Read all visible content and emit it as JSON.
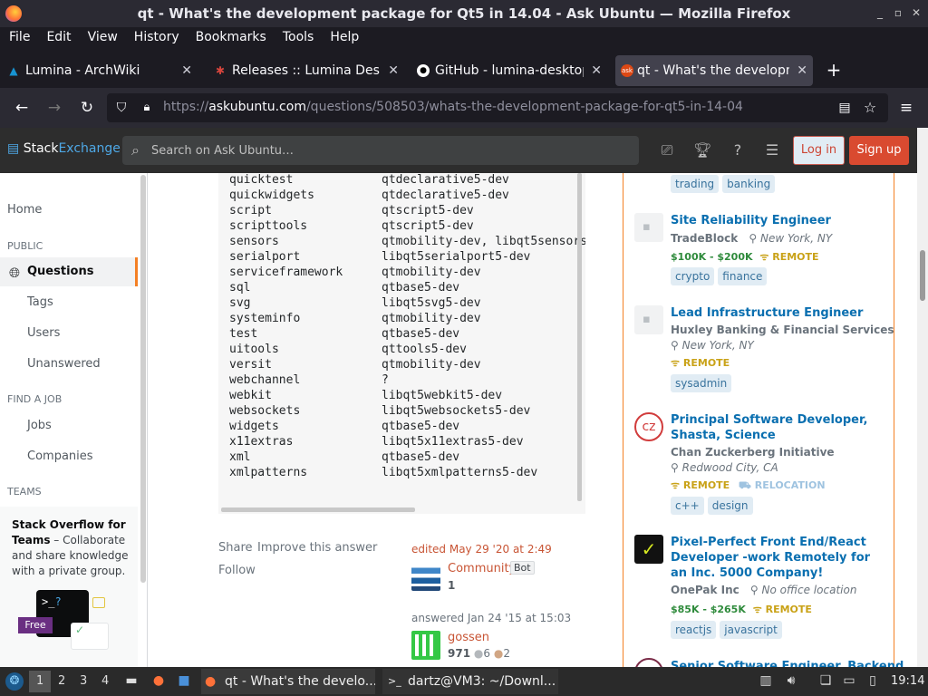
{
  "window": {
    "title": "qt - What's the development package for Qt5 in 14.04 - Ask Ubuntu — Mozilla Firefox"
  },
  "menu": [
    "File",
    "Edit",
    "View",
    "History",
    "Bookmarks",
    "Tools",
    "Help"
  ],
  "tabs": [
    {
      "label": "Lumina - ArchWiki",
      "icon": "archwiki-icon"
    },
    {
      "label": "Releases :: Lumina Deskt",
      "icon": "lumina-icon"
    },
    {
      "label": "GitHub - lumina-desktop/",
      "icon": "github-icon"
    },
    {
      "label": "qt - What's the developme",
      "icon": "askubuntu-icon"
    }
  ],
  "url": {
    "prefix": "https://",
    "domain": "askubuntu.com",
    "path": "/questions/508503/whats-the-development-package-for-qt5-in-14-04"
  },
  "header": {
    "logo_stack": "Stack",
    "logo_exchange": "Exchange",
    "search_placeholder": "Search on Ask Ubuntu…",
    "login": "Log in",
    "signup": "Sign up"
  },
  "leftnav": {
    "home": "Home",
    "public": "PUBLIC",
    "questions": "Questions",
    "tags": "Tags",
    "users": "Users",
    "unanswered": "Unanswered",
    "find_a_job": "FIND A JOB",
    "jobs": "Jobs",
    "companies": "Companies",
    "teams": "TEAMS",
    "teams_title": "Stack Overflow for Teams",
    "teams_text": " – Collaborate and share knowledge with a private group.",
    "free": "Free"
  },
  "code_rows": [
    [
      "quicktest",
      "qtdeclarative5-dev"
    ],
    [
      "quickwidgets",
      "qtdeclarative5-dev"
    ],
    [
      "script",
      "qtscript5-dev"
    ],
    [
      "scripttools",
      "qtscript5-dev"
    ],
    [
      "sensors",
      "qtmobility-dev, libqt5sensors"
    ],
    [
      "serialport",
      "libqt5serialport5-dev"
    ],
    [
      "serviceframework",
      "qtmobility-dev"
    ],
    [
      "sql",
      "qtbase5-dev"
    ],
    [
      "svg",
      "libqt5svg5-dev"
    ],
    [
      "systeminfo",
      "qtmobility-dev"
    ],
    [
      "test",
      "qtbase5-dev"
    ],
    [
      "uitools",
      "qttools5-dev"
    ],
    [
      "versit",
      "qtmobility-dev"
    ],
    [
      "webchannel",
      "?"
    ],
    [
      "webkit",
      "libqt5webkit5-dev"
    ],
    [
      "websockets",
      "libqt5websockets5-dev"
    ],
    [
      "widgets",
      "qtbase5-dev"
    ],
    [
      "x11extras",
      "libqt5x11extras5-dev"
    ],
    [
      "xml",
      "qtbase5-dev"
    ],
    [
      "xmlpatterns",
      "libqt5xmlpatterns5-dev"
    ]
  ],
  "post": {
    "share": "Share",
    "improve": "Improve this answer",
    "follow": "Follow",
    "edited": "edited May 29 '20 at 2:49",
    "editor": "Community",
    "bot": "Bot",
    "editor_rep": "1",
    "answered": "answered Jan 24 '15 at 15:03",
    "author": "gossen",
    "author_rep": "971",
    "silver": "6",
    "bronze": "2"
  },
  "jobs": [
    {
      "title": "",
      "company": "",
      "location": "",
      "salary": "",
      "remote": "",
      "relocation": "",
      "tags": [
        "trading",
        "banking"
      ]
    },
    {
      "title": "Site Reliability Engineer",
      "company": "TradeBlock",
      "location": "New York, NY",
      "salary": "$100K - $200K",
      "remote": "REMOTE",
      "relocation": "",
      "tags": [
        "crypto",
        "finance"
      ]
    },
    {
      "title": "Lead Infrastructure Engineer",
      "company": "Huxley Banking & Financial Services",
      "location": "New York, NY",
      "salary": "",
      "remote": "REMOTE",
      "relocation": "",
      "tags": [
        "sysadmin"
      ]
    },
    {
      "title": "Principal Software Developer, Shasta, Science",
      "company": "Chan Zuckerberg Initiative",
      "location": "Redwood City, CA",
      "salary": "",
      "remote": "REMOTE",
      "relocation": "RELOCATION",
      "tags": [
        "c++",
        "design"
      ]
    },
    {
      "title": "Pixel-Perfect Front End/React Developer -work Remotely for an Inc. 5000 Company!",
      "company": "OnePak Inc",
      "location": "No office location",
      "salary": "$85K - $265K",
      "remote": "REMOTE",
      "relocation": "",
      "tags": [
        "reactjs",
        "javascript"
      ]
    },
    {
      "title": "Senior Software Engineer, Backend",
      "company": "",
      "location": "",
      "salary": "",
      "remote": "",
      "relocation": "",
      "tags": []
    }
  ],
  "taskbar": {
    "workspaces": [
      "1",
      "2",
      "3",
      "4"
    ],
    "app1": "qt - What's the develo...",
    "app2": "dartz@VM3: ~/Downl...",
    "clock": "19:14"
  }
}
